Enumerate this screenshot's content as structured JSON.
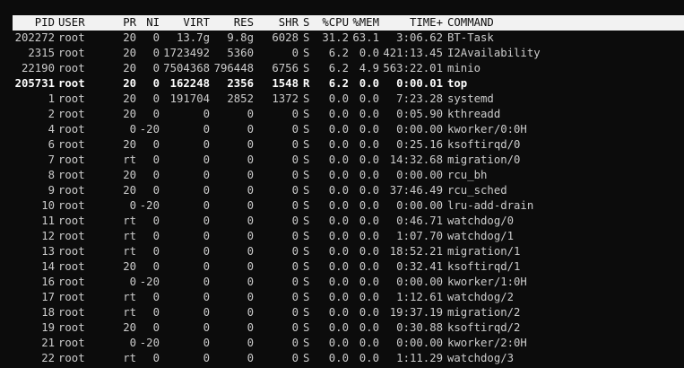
{
  "colors": {
    "background": "#0c0c0c",
    "text": "#cccccc",
    "highlight_text": "#ffffff",
    "header_background": "#f2f2f2",
    "header_text": "#0c0c0c"
  },
  "header": {
    "pid": "PID",
    "user": "USER",
    "pr": "PR",
    "ni": "NI",
    "virt": "VIRT",
    "res": "RES",
    "shr": "SHR",
    "s": "S",
    "cpu": "%CPU",
    "mem": "%MEM",
    "time": "TIME+",
    "command": "COMMAND"
  },
  "processes": [
    {
      "pid": "202272",
      "user": "root",
      "pr": "20",
      "ni": "0",
      "virt": "13.7g",
      "res": "9.8g",
      "shr": "6028",
      "s": "S",
      "cpu": "31.2",
      "mem": "63.1",
      "time": "3:06.62",
      "command": "BT-Task",
      "bold": false
    },
    {
      "pid": "2315",
      "user": "root",
      "pr": "20",
      "ni": "0",
      "virt": "1723492",
      "res": "5360",
      "shr": "0",
      "s": "S",
      "cpu": "6.2",
      "mem": "0.0",
      "time": "421:13.45",
      "command": "I2Availability",
      "bold": false
    },
    {
      "pid": "22190",
      "user": "root",
      "pr": "20",
      "ni": "0",
      "virt": "7504368",
      "res": "796448",
      "shr": "6756",
      "s": "S",
      "cpu": "6.2",
      "mem": "4.9",
      "time": "563:22.01",
      "command": "minio",
      "bold": false
    },
    {
      "pid": "205731",
      "user": "root",
      "pr": "20",
      "ni": "0",
      "virt": "162248",
      "res": "2356",
      "shr": "1548",
      "s": "R",
      "cpu": "6.2",
      "mem": "0.0",
      "time": "0:00.01",
      "command": "top",
      "bold": true
    },
    {
      "pid": "1",
      "user": "root",
      "pr": "20",
      "ni": "0",
      "virt": "191704",
      "res": "2852",
      "shr": "1372",
      "s": "S",
      "cpu": "0.0",
      "mem": "0.0",
      "time": "7:23.28",
      "command": "systemd",
      "bold": false
    },
    {
      "pid": "2",
      "user": "root",
      "pr": "20",
      "ni": "0",
      "virt": "0",
      "res": "0",
      "shr": "0",
      "s": "S",
      "cpu": "0.0",
      "mem": "0.0",
      "time": "0:05.90",
      "command": "kthreadd",
      "bold": false
    },
    {
      "pid": "4",
      "user": "root",
      "pr": "0",
      "ni": "-20",
      "virt": "0",
      "res": "0",
      "shr": "0",
      "s": "S",
      "cpu": "0.0",
      "mem": "0.0",
      "time": "0:00.00",
      "command": "kworker/0:0H",
      "bold": false
    },
    {
      "pid": "6",
      "user": "root",
      "pr": "20",
      "ni": "0",
      "virt": "0",
      "res": "0",
      "shr": "0",
      "s": "S",
      "cpu": "0.0",
      "mem": "0.0",
      "time": "0:25.16",
      "command": "ksoftirqd/0",
      "bold": false
    },
    {
      "pid": "7",
      "user": "root",
      "pr": "rt",
      "ni": "0",
      "virt": "0",
      "res": "0",
      "shr": "0",
      "s": "S",
      "cpu": "0.0",
      "mem": "0.0",
      "time": "14:32.68",
      "command": "migration/0",
      "bold": false
    },
    {
      "pid": "8",
      "user": "root",
      "pr": "20",
      "ni": "0",
      "virt": "0",
      "res": "0",
      "shr": "0",
      "s": "S",
      "cpu": "0.0",
      "mem": "0.0",
      "time": "0:00.00",
      "command": "rcu_bh",
      "bold": false
    },
    {
      "pid": "9",
      "user": "root",
      "pr": "20",
      "ni": "0",
      "virt": "0",
      "res": "0",
      "shr": "0",
      "s": "S",
      "cpu": "0.0",
      "mem": "0.0",
      "time": "37:46.49",
      "command": "rcu_sched",
      "bold": false
    },
    {
      "pid": "10",
      "user": "root",
      "pr": "0",
      "ni": "-20",
      "virt": "0",
      "res": "0",
      "shr": "0",
      "s": "S",
      "cpu": "0.0",
      "mem": "0.0",
      "time": "0:00.00",
      "command": "lru-add-drain",
      "bold": false
    },
    {
      "pid": "11",
      "user": "root",
      "pr": "rt",
      "ni": "0",
      "virt": "0",
      "res": "0",
      "shr": "0",
      "s": "S",
      "cpu": "0.0",
      "mem": "0.0",
      "time": "0:46.71",
      "command": "watchdog/0",
      "bold": false
    },
    {
      "pid": "12",
      "user": "root",
      "pr": "rt",
      "ni": "0",
      "virt": "0",
      "res": "0",
      "shr": "0",
      "s": "S",
      "cpu": "0.0",
      "mem": "0.0",
      "time": "1:07.70",
      "command": "watchdog/1",
      "bold": false
    },
    {
      "pid": "13",
      "user": "root",
      "pr": "rt",
      "ni": "0",
      "virt": "0",
      "res": "0",
      "shr": "0",
      "s": "S",
      "cpu": "0.0",
      "mem": "0.0",
      "time": "18:52.21",
      "command": "migration/1",
      "bold": false
    },
    {
      "pid": "14",
      "user": "root",
      "pr": "20",
      "ni": "0",
      "virt": "0",
      "res": "0",
      "shr": "0",
      "s": "S",
      "cpu": "0.0",
      "mem": "0.0",
      "time": "0:32.41",
      "command": "ksoftirqd/1",
      "bold": false
    },
    {
      "pid": "16",
      "user": "root",
      "pr": "0",
      "ni": "-20",
      "virt": "0",
      "res": "0",
      "shr": "0",
      "s": "S",
      "cpu": "0.0",
      "mem": "0.0",
      "time": "0:00.00",
      "command": "kworker/1:0H",
      "bold": false
    },
    {
      "pid": "17",
      "user": "root",
      "pr": "rt",
      "ni": "0",
      "virt": "0",
      "res": "0",
      "shr": "0",
      "s": "S",
      "cpu": "0.0",
      "mem": "0.0",
      "time": "1:12.61",
      "command": "watchdog/2",
      "bold": false
    },
    {
      "pid": "18",
      "user": "root",
      "pr": "rt",
      "ni": "0",
      "virt": "0",
      "res": "0",
      "shr": "0",
      "s": "S",
      "cpu": "0.0",
      "mem": "0.0",
      "time": "19:37.19",
      "command": "migration/2",
      "bold": false
    },
    {
      "pid": "19",
      "user": "root",
      "pr": "20",
      "ni": "0",
      "virt": "0",
      "res": "0",
      "shr": "0",
      "s": "S",
      "cpu": "0.0",
      "mem": "0.0",
      "time": "0:30.88",
      "command": "ksoftirqd/2",
      "bold": false
    },
    {
      "pid": "21",
      "user": "root",
      "pr": "0",
      "ni": "-20",
      "virt": "0",
      "res": "0",
      "shr": "0",
      "s": "S",
      "cpu": "0.0",
      "mem": "0.0",
      "time": "0:00.00",
      "command": "kworker/2:0H",
      "bold": false
    },
    {
      "pid": "22",
      "user": "root",
      "pr": "rt",
      "ni": "0",
      "virt": "0",
      "res": "0",
      "shr": "0",
      "s": "S",
      "cpu": "0.0",
      "mem": "0.0",
      "time": "1:11.29",
      "command": "watchdog/3",
      "bold": false
    }
  ]
}
